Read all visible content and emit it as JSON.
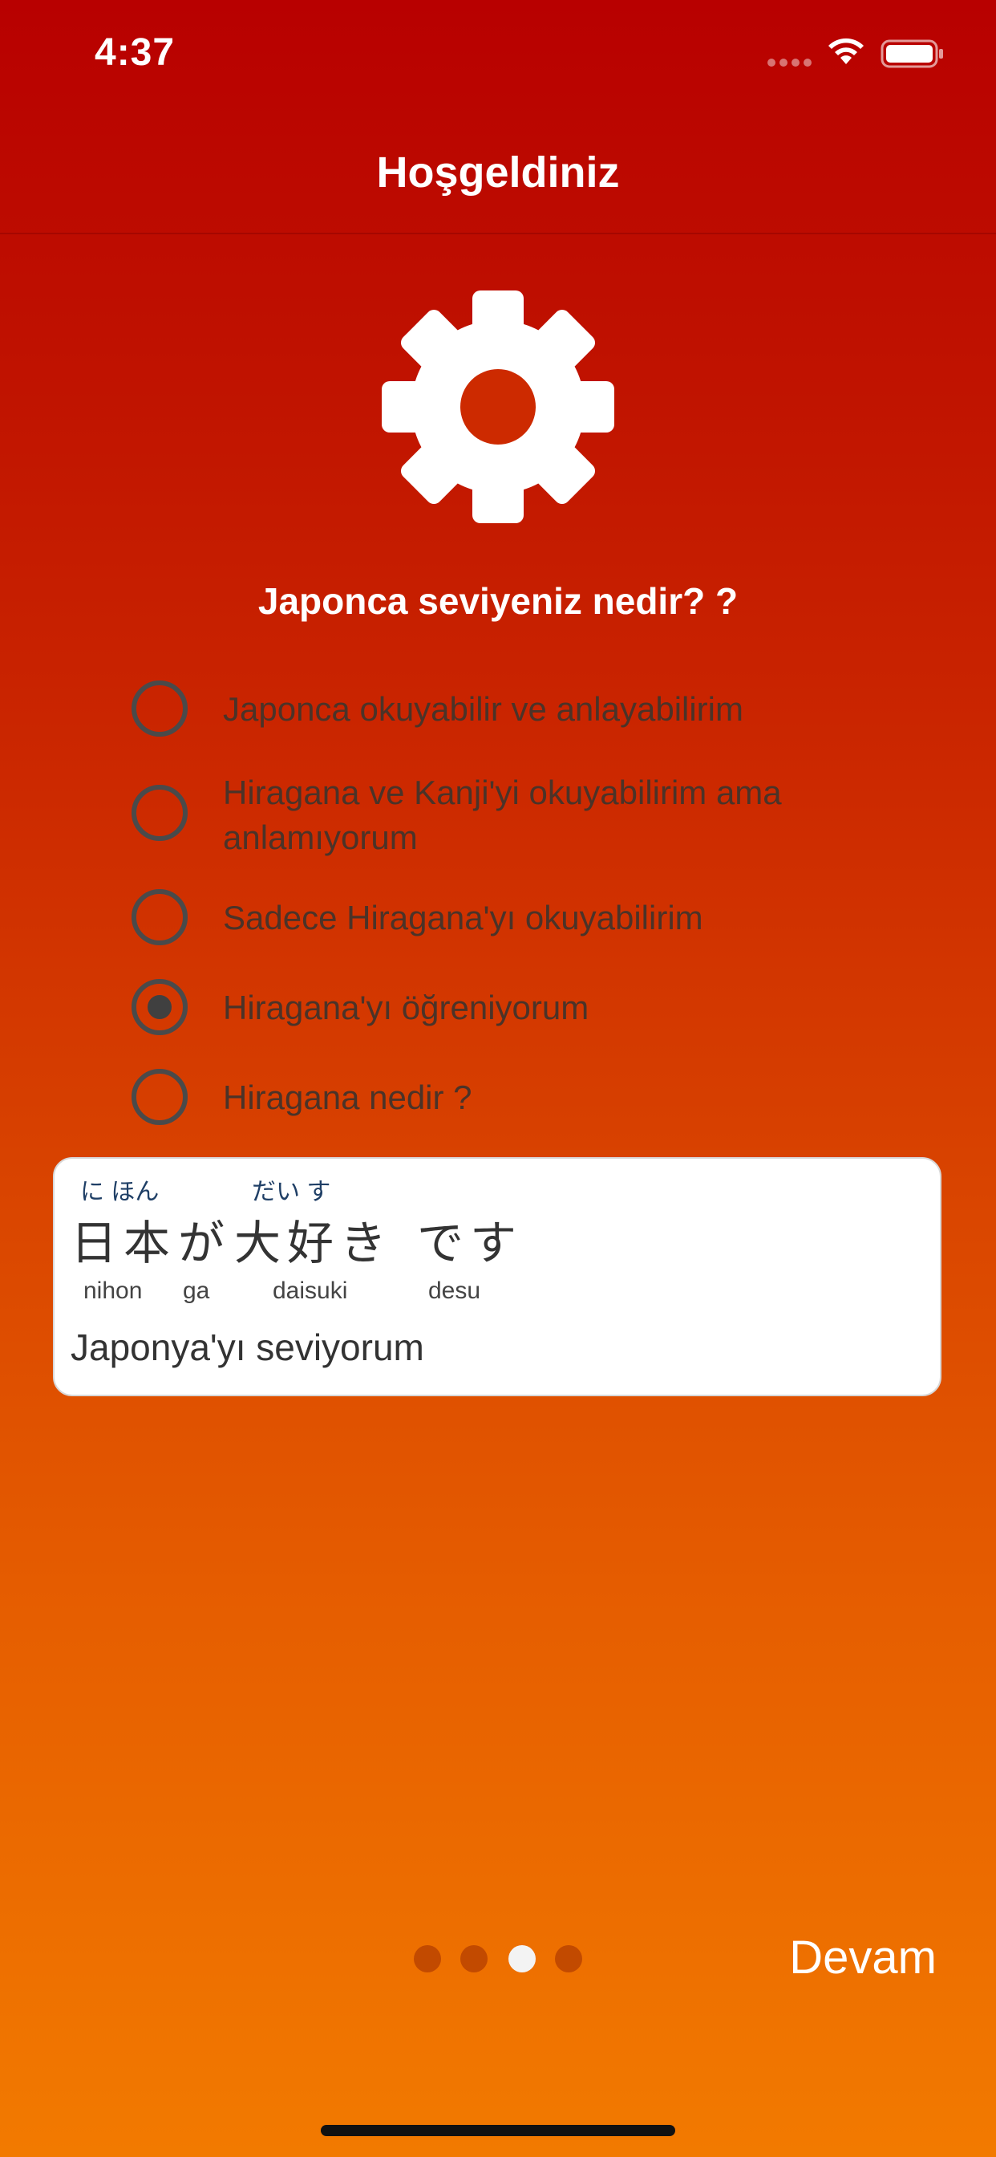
{
  "status_bar": {
    "time": "4:37"
  },
  "nav": {
    "title": "Hoşgeldiniz"
  },
  "question": "Japonca seviyeniz nedir? ?",
  "options": [
    {
      "label": "Japonca okuyabilir ve anlayabilirim",
      "selected": false
    },
    {
      "label": "Hiragana ve Kanji'yi okuyabilirim ama anlamıyorum",
      "selected": false
    },
    {
      "label": "Sadece Hiragana'yı okuyabilirim",
      "selected": false
    },
    {
      "label": "Hiragana'yı öğreniyorum",
      "selected": true
    },
    {
      "label": "Hiragana nedir ?",
      "selected": false
    }
  ],
  "example": {
    "words": [
      {
        "furigana": "に ほん",
        "text": "日本",
        "romaji": "nihon"
      },
      {
        "furigana": "",
        "text": "が",
        "romaji": "ga"
      },
      {
        "furigana": "だい す",
        "text": "大好き",
        "romaji": "daisuki"
      },
      {
        "furigana": "",
        "text": "です",
        "romaji": "desu"
      }
    ],
    "translation": "Japonya'yı seviyorum"
  },
  "pagination": {
    "total": 4,
    "current_index": 2
  },
  "continue_label": "Devam",
  "colors": {
    "gradient_top": "#b80000",
    "gradient_bottom": "#f27a00",
    "radio_border": "#4a4a4a",
    "option_text": "#4b3328"
  },
  "icons": {
    "main": "gear-icon"
  }
}
